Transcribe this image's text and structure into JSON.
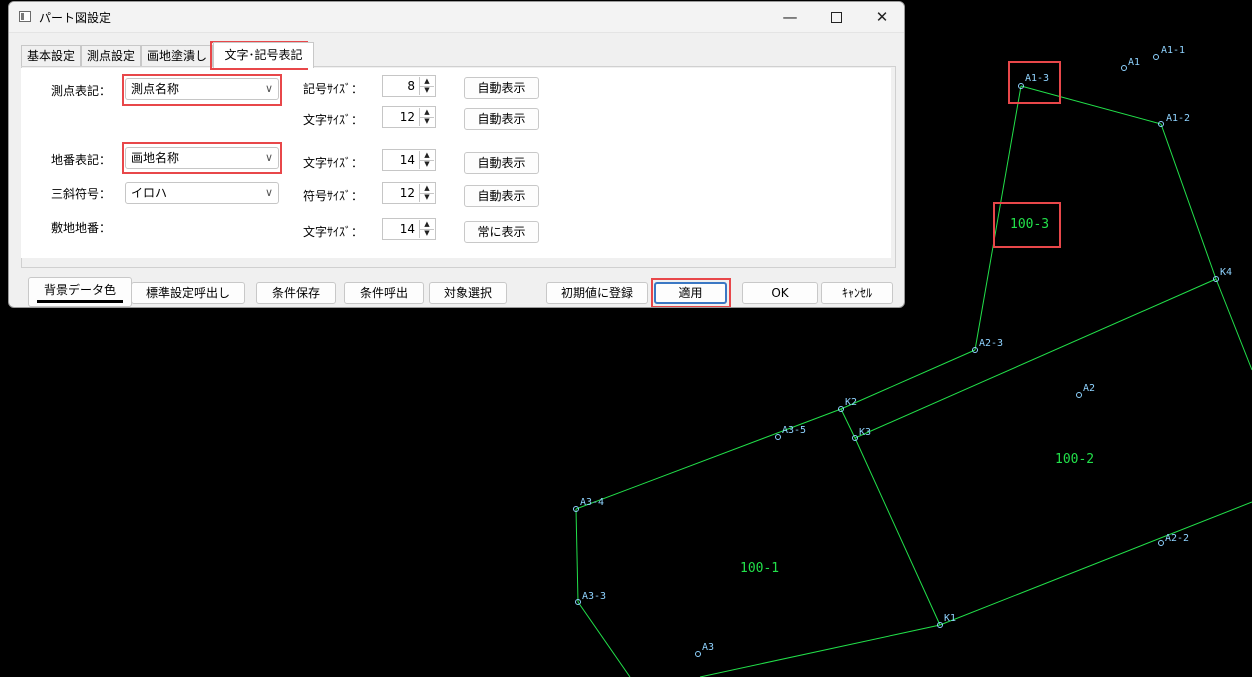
{
  "window": {
    "title": "パート図設定"
  },
  "tabs": [
    {
      "label": "基本設定"
    },
    {
      "label": "測点設定"
    },
    {
      "label": "画地塗潰し"
    },
    {
      "label": "文字･記号表記"
    }
  ],
  "form": {
    "point_label": "測点表記：",
    "point_value": "測点名称",
    "lot_label": "地番表記：",
    "lot_value": "画地名称",
    "sankaku_label": "三斜符号：",
    "sankaku_value": "イロハ",
    "site_label": "敷地地番：",
    "rows": [
      {
        "label": "記号ｻｲｽﾞ：",
        "value": "8",
        "button": "自動表示"
      },
      {
        "label": "文字ｻｲｽﾞ：",
        "value": "12",
        "button": "自動表示"
      },
      {
        "label": "文字ｻｲｽﾞ：",
        "value": "14",
        "button": "自動表示"
      },
      {
        "label": "符号ｻｲｽﾞ：",
        "value": "12",
        "button": "自動表示"
      },
      {
        "label": "文字ｻｲｽﾞ：",
        "value": "14",
        "button": "常に表示"
      }
    ]
  },
  "footer": {
    "bg_color": "背景データ色",
    "std_call": "標準設定呼出し",
    "save_cond": "条件保存",
    "load_cond": "条件呼出",
    "select_target": "対象選択",
    "register_default": "初期値に登録",
    "apply": "適用",
    "ok": "OK",
    "cancel": "ｷｬﾝｾﾙ"
  },
  "cad": {
    "line_color": "#22e04a",
    "point_color": "#8fd3ff",
    "highlight_color": "#e8474a",
    "point_labels": [
      "A1",
      "A1-1",
      "A1-3",
      "A1-2",
      "K4",
      "A2-3",
      "A2",
      "K2",
      "K3",
      "A3-5",
      "A3-4",
      "A2-2",
      "A3-3",
      "K1",
      "A3"
    ],
    "parcel_labels": [
      "100-3",
      "100-2",
      "100-1"
    ]
  }
}
